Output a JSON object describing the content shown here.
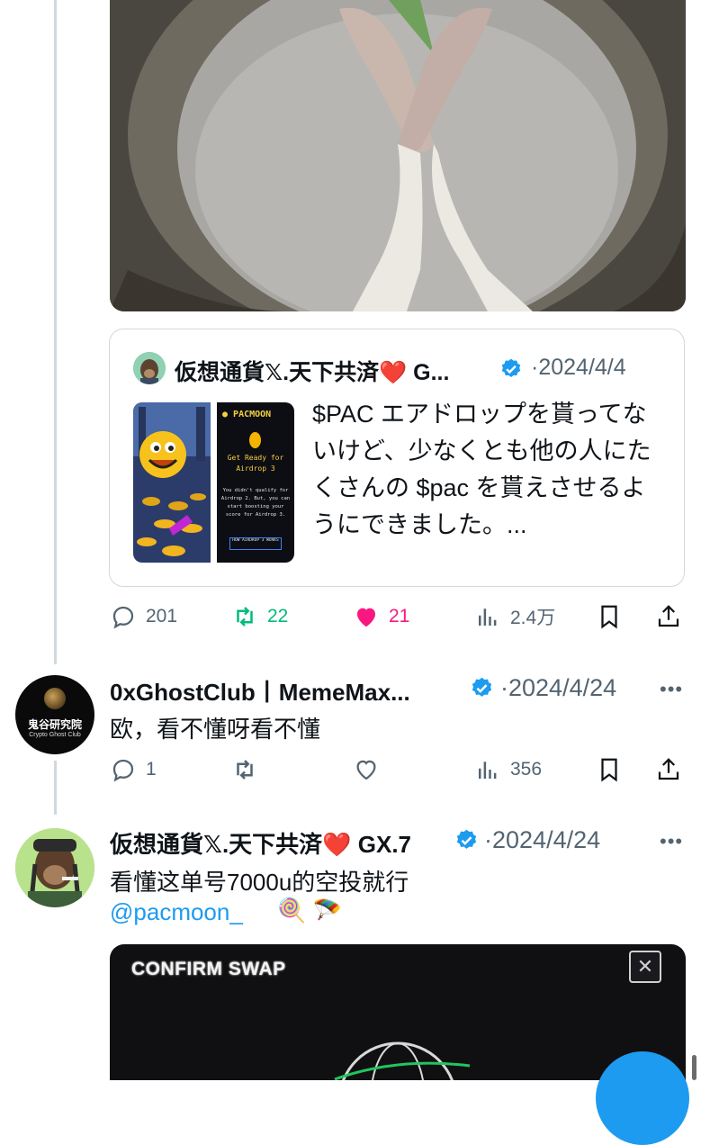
{
  "quote": {
    "author": "仮想通貨𝕏.天下共済❤️ G...",
    "date": "2024/4/4",
    "text": "$PAC エアドロップを貰ってないけど、少なくとも他の人にたくさんの $pac を貰えさせるようにできました。...",
    "card": {
      "brand": "PACMOON",
      "heading": "Get Ready for Airdrop 3",
      "body": "You didn't qualify for Airdrop 2. But, you can start boosting your score for Airdrop 3.",
      "button": "HOW AIRDROP 3 WORKS"
    }
  },
  "tweet1_actions": {
    "replies": "201",
    "retweets": "22",
    "likes": "21",
    "views": "2.4万"
  },
  "reply1": {
    "avatar_text": "鬼谷研究院",
    "avatar_subtext": "Crypto Ghost Club",
    "name": "0xGhostClub丨MemeMax...",
    "date": "2024/4/24",
    "text": "欧，看不懂呀看不懂",
    "actions": {
      "replies": "1",
      "retweets": "",
      "likes": "",
      "views": "356"
    }
  },
  "reply2": {
    "name": "仮想通貨𝕏.天下共済❤️ GX.7",
    "date": "2024/4/24",
    "text": "看懂这单号7000u的空投就行",
    "mention": "@pacmoon_",
    "emojis": "🍭 🪂",
    "media_title": "CONFIRM SWAP",
    "media_close": "✕"
  },
  "separator": "·",
  "more_glyph": "•••",
  "colors": {
    "accent": "#1d9bf0",
    "retweet": "#00ba7c",
    "like": "#f91880",
    "muted": "#536471"
  }
}
